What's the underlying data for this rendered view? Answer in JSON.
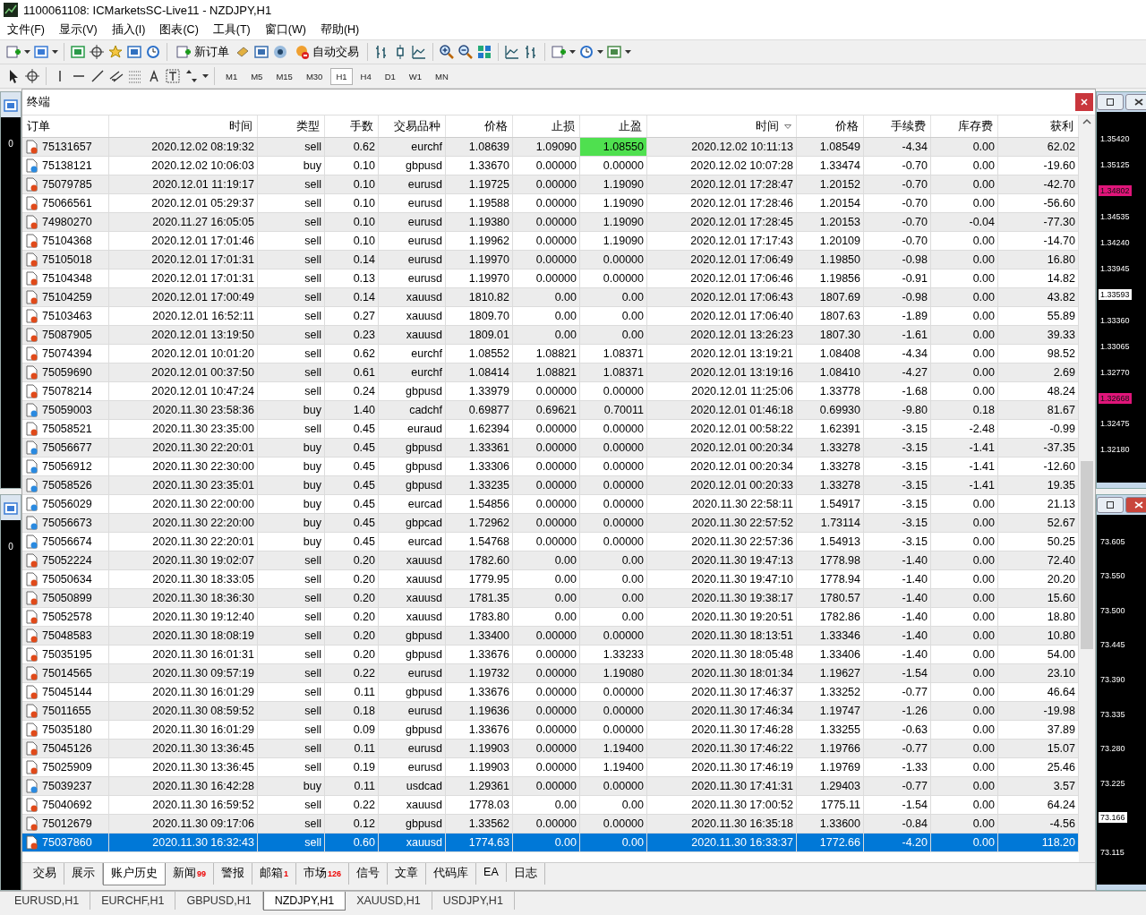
{
  "window": {
    "title": "1100061108: ICMarketsSC-Live11 - NZDJPY,H1"
  },
  "menu": [
    "文件(F)",
    "显示(V)",
    "插入(I)",
    "图表(C)",
    "工具(T)",
    "窗口(W)",
    "帮助(H)"
  ],
  "toolbar": {
    "new_order": "新订单",
    "auto_trading": "自动交易"
  },
  "timeframes": [
    {
      "label": "M1",
      "selected": false
    },
    {
      "label": "M5",
      "selected": false
    },
    {
      "label": "M15",
      "selected": false
    },
    {
      "label": "M30",
      "selected": false
    },
    {
      "label": "H1",
      "selected": true
    },
    {
      "label": "H4",
      "selected": false
    },
    {
      "label": "D1",
      "selected": false
    },
    {
      "label": "W1",
      "selected": false
    },
    {
      "label": "MN",
      "selected": false
    }
  ],
  "left_charts": [
    {
      "label": "0"
    },
    {
      "label": "0"
    }
  ],
  "terminal": {
    "title": "终端",
    "columns": [
      "订单",
      "时间",
      "类型",
      "手数",
      "交易品种",
      "价格",
      "止损",
      "止盈",
      "时间",
      "价格",
      "手续费",
      "库存费",
      "获利"
    ],
    "rows": [
      {
        "kind": "sell",
        "selected": false,
        "tp_hit": true,
        "cells": [
          "75131657",
          "2020.12.02 08:19:32",
          "sell",
          "0.62",
          "eurchf",
          "1.08639",
          "1.09090",
          "1.08550",
          "2020.12.02 10:11:13",
          "1.08549",
          "-4.34",
          "0.00",
          "62.02"
        ]
      },
      {
        "kind": "buy",
        "selected": false,
        "tp_hit": false,
        "cells": [
          "75138121",
          "2020.12.02 10:06:03",
          "buy",
          "0.10",
          "gbpusd",
          "1.33670",
          "0.00000",
          "0.00000",
          "2020.12.02 10:07:28",
          "1.33474",
          "-0.70",
          "0.00",
          "-19.60"
        ]
      },
      {
        "kind": "sell",
        "selected": false,
        "tp_hit": false,
        "cells": [
          "75079785",
          "2020.12.01 11:19:17",
          "sell",
          "0.10",
          "eurusd",
          "1.19725",
          "0.00000",
          "1.19090",
          "2020.12.01 17:28:47",
          "1.20152",
          "-0.70",
          "0.00",
          "-42.70"
        ]
      },
      {
        "kind": "sell",
        "selected": false,
        "tp_hit": false,
        "cells": [
          "75066561",
          "2020.12.01 05:29:37",
          "sell",
          "0.10",
          "eurusd",
          "1.19588",
          "0.00000",
          "1.19090",
          "2020.12.01 17:28:46",
          "1.20154",
          "-0.70",
          "0.00",
          "-56.60"
        ]
      },
      {
        "kind": "sell",
        "selected": false,
        "tp_hit": false,
        "cells": [
          "74980270",
          "2020.11.27 16:05:05",
          "sell",
          "0.10",
          "eurusd",
          "1.19380",
          "0.00000",
          "1.19090",
          "2020.12.01 17:28:45",
          "1.20153",
          "-0.70",
          "-0.04",
          "-77.30"
        ]
      },
      {
        "kind": "sell",
        "selected": false,
        "tp_hit": false,
        "cells": [
          "75104368",
          "2020.12.01 17:01:46",
          "sell",
          "0.10",
          "eurusd",
          "1.19962",
          "0.00000",
          "1.19090",
          "2020.12.01 17:17:43",
          "1.20109",
          "-0.70",
          "0.00",
          "-14.70"
        ]
      },
      {
        "kind": "sell",
        "selected": false,
        "tp_hit": false,
        "cells": [
          "75105018",
          "2020.12.01 17:01:31",
          "sell",
          "0.14",
          "eurusd",
          "1.19970",
          "0.00000",
          "0.00000",
          "2020.12.01 17:06:49",
          "1.19850",
          "-0.98",
          "0.00",
          "16.80"
        ]
      },
      {
        "kind": "sell",
        "selected": false,
        "tp_hit": false,
        "cells": [
          "75104348",
          "2020.12.01 17:01:31",
          "sell",
          "0.13",
          "eurusd",
          "1.19970",
          "0.00000",
          "0.00000",
          "2020.12.01 17:06:46",
          "1.19856",
          "-0.91",
          "0.00",
          "14.82"
        ]
      },
      {
        "kind": "sell",
        "selected": false,
        "tp_hit": false,
        "cells": [
          "75104259",
          "2020.12.01 17:00:49",
          "sell",
          "0.14",
          "xauusd",
          "1810.82",
          "0.00",
          "0.00",
          "2020.12.01 17:06:43",
          "1807.69",
          "-0.98",
          "0.00",
          "43.82"
        ]
      },
      {
        "kind": "sell",
        "selected": false,
        "tp_hit": false,
        "cells": [
          "75103463",
          "2020.12.01 16:52:11",
          "sell",
          "0.27",
          "xauusd",
          "1809.70",
          "0.00",
          "0.00",
          "2020.12.01 17:06:40",
          "1807.63",
          "-1.89",
          "0.00",
          "55.89"
        ]
      },
      {
        "kind": "sell",
        "selected": false,
        "tp_hit": false,
        "cells": [
          "75087905",
          "2020.12.01 13:19:50",
          "sell",
          "0.23",
          "xauusd",
          "1809.01",
          "0.00",
          "0.00",
          "2020.12.01 13:26:23",
          "1807.30",
          "-1.61",
          "0.00",
          "39.33"
        ]
      },
      {
        "kind": "sell",
        "selected": false,
        "tp_hit": false,
        "cells": [
          "75074394",
          "2020.12.01 10:01:20",
          "sell",
          "0.62",
          "eurchf",
          "1.08552",
          "1.08821",
          "1.08371",
          "2020.12.01 13:19:21",
          "1.08408",
          "-4.34",
          "0.00",
          "98.52"
        ]
      },
      {
        "kind": "sell",
        "selected": false,
        "tp_hit": false,
        "cells": [
          "75059690",
          "2020.12.01 00:37:50",
          "sell",
          "0.61",
          "eurchf",
          "1.08414",
          "1.08821",
          "1.08371",
          "2020.12.01 13:19:16",
          "1.08410",
          "-4.27",
          "0.00",
          "2.69"
        ]
      },
      {
        "kind": "sell",
        "selected": false,
        "tp_hit": false,
        "cells": [
          "75078214",
          "2020.12.01 10:47:24",
          "sell",
          "0.24",
          "gbpusd",
          "1.33979",
          "0.00000",
          "0.00000",
          "2020.12.01 11:25:06",
          "1.33778",
          "-1.68",
          "0.00",
          "48.24"
        ]
      },
      {
        "kind": "buy",
        "selected": false,
        "tp_hit": false,
        "cells": [
          "75059003",
          "2020.11.30 23:58:36",
          "buy",
          "1.40",
          "cadchf",
          "0.69877",
          "0.69621",
          "0.70011",
          "2020.12.01 01:46:18",
          "0.69930",
          "-9.80",
          "0.18",
          "81.67"
        ]
      },
      {
        "kind": "sell",
        "selected": false,
        "tp_hit": false,
        "cells": [
          "75058521",
          "2020.11.30 23:35:00",
          "sell",
          "0.45",
          "euraud",
          "1.62394",
          "0.00000",
          "0.00000",
          "2020.12.01 00:58:22",
          "1.62391",
          "-3.15",
          "-2.48",
          "-0.99"
        ]
      },
      {
        "kind": "buy",
        "selected": false,
        "tp_hit": false,
        "cells": [
          "75056677",
          "2020.11.30 22:20:01",
          "buy",
          "0.45",
          "gbpusd",
          "1.33361",
          "0.00000",
          "0.00000",
          "2020.12.01 00:20:34",
          "1.33278",
          "-3.15",
          "-1.41",
          "-37.35"
        ]
      },
      {
        "kind": "buy",
        "selected": false,
        "tp_hit": false,
        "cells": [
          "75056912",
          "2020.11.30 22:30:00",
          "buy",
          "0.45",
          "gbpusd",
          "1.33306",
          "0.00000",
          "0.00000",
          "2020.12.01 00:20:34",
          "1.33278",
          "-3.15",
          "-1.41",
          "-12.60"
        ]
      },
      {
        "kind": "buy",
        "selected": false,
        "tp_hit": false,
        "cells": [
          "75058526",
          "2020.11.30 23:35:01",
          "buy",
          "0.45",
          "gbpusd",
          "1.33235",
          "0.00000",
          "0.00000",
          "2020.12.01 00:20:33",
          "1.33278",
          "-3.15",
          "-1.41",
          "19.35"
        ]
      },
      {
        "kind": "buy",
        "selected": false,
        "tp_hit": false,
        "cells": [
          "75056029",
          "2020.11.30 22:00:00",
          "buy",
          "0.45",
          "eurcad",
          "1.54856",
          "0.00000",
          "0.00000",
          "2020.11.30 22:58:11",
          "1.54917",
          "-3.15",
          "0.00",
          "21.13"
        ]
      },
      {
        "kind": "buy",
        "selected": false,
        "tp_hit": false,
        "cells": [
          "75056673",
          "2020.11.30 22:20:00",
          "buy",
          "0.45",
          "gbpcad",
          "1.72962",
          "0.00000",
          "0.00000",
          "2020.11.30 22:57:52",
          "1.73114",
          "-3.15",
          "0.00",
          "52.67"
        ]
      },
      {
        "kind": "buy",
        "selected": false,
        "tp_hit": false,
        "cells": [
          "75056674",
          "2020.11.30 22:20:01",
          "buy",
          "0.45",
          "eurcad",
          "1.54768",
          "0.00000",
          "0.00000",
          "2020.11.30 22:57:36",
          "1.54913",
          "-3.15",
          "0.00",
          "50.25"
        ]
      },
      {
        "kind": "sell",
        "selected": false,
        "tp_hit": false,
        "cells": [
          "75052224",
          "2020.11.30 19:02:07",
          "sell",
          "0.20",
          "xauusd",
          "1782.60",
          "0.00",
          "0.00",
          "2020.11.30 19:47:13",
          "1778.98",
          "-1.40",
          "0.00",
          "72.40"
        ]
      },
      {
        "kind": "sell",
        "selected": false,
        "tp_hit": false,
        "cells": [
          "75050634",
          "2020.11.30 18:33:05",
          "sell",
          "0.20",
          "xauusd",
          "1779.95",
          "0.00",
          "0.00",
          "2020.11.30 19:47:10",
          "1778.94",
          "-1.40",
          "0.00",
          "20.20"
        ]
      },
      {
        "kind": "sell",
        "selected": false,
        "tp_hit": false,
        "cells": [
          "75050899",
          "2020.11.30 18:36:30",
          "sell",
          "0.20",
          "xauusd",
          "1781.35",
          "0.00",
          "0.00",
          "2020.11.30 19:38:17",
          "1780.57",
          "-1.40",
          "0.00",
          "15.60"
        ]
      },
      {
        "kind": "sell",
        "selected": false,
        "tp_hit": false,
        "cells": [
          "75052578",
          "2020.11.30 19:12:40",
          "sell",
          "0.20",
          "xauusd",
          "1783.80",
          "0.00",
          "0.00",
          "2020.11.30 19:20:51",
          "1782.86",
          "-1.40",
          "0.00",
          "18.80"
        ]
      },
      {
        "kind": "sell",
        "selected": false,
        "tp_hit": false,
        "cells": [
          "75048583",
          "2020.11.30 18:08:19",
          "sell",
          "0.20",
          "gbpusd",
          "1.33400",
          "0.00000",
          "0.00000",
          "2020.11.30 18:13:51",
          "1.33346",
          "-1.40",
          "0.00",
          "10.80"
        ]
      },
      {
        "kind": "sell",
        "selected": false,
        "tp_hit": false,
        "cells": [
          "75035195",
          "2020.11.30 16:01:31",
          "sell",
          "0.20",
          "gbpusd",
          "1.33676",
          "0.00000",
          "1.33233",
          "2020.11.30 18:05:48",
          "1.33406",
          "-1.40",
          "0.00",
          "54.00"
        ]
      },
      {
        "kind": "sell",
        "selected": false,
        "tp_hit": false,
        "cells": [
          "75014565",
          "2020.11.30 09:57:19",
          "sell",
          "0.22",
          "eurusd",
          "1.19732",
          "0.00000",
          "1.19080",
          "2020.11.30 18:01:34",
          "1.19627",
          "-1.54",
          "0.00",
          "23.10"
        ]
      },
      {
        "kind": "sell",
        "selected": false,
        "tp_hit": false,
        "cells": [
          "75045144",
          "2020.11.30 16:01:29",
          "sell",
          "0.11",
          "gbpusd",
          "1.33676",
          "0.00000",
          "0.00000",
          "2020.11.30 17:46:37",
          "1.33252",
          "-0.77",
          "0.00",
          "46.64"
        ]
      },
      {
        "kind": "sell",
        "selected": false,
        "tp_hit": false,
        "cells": [
          "75011655",
          "2020.11.30 08:59:52",
          "sell",
          "0.18",
          "eurusd",
          "1.19636",
          "0.00000",
          "0.00000",
          "2020.11.30 17:46:34",
          "1.19747",
          "-1.26",
          "0.00",
          "-19.98"
        ]
      },
      {
        "kind": "sell",
        "selected": false,
        "tp_hit": false,
        "cells": [
          "75035180",
          "2020.11.30 16:01:29",
          "sell",
          "0.09",
          "gbpusd",
          "1.33676",
          "0.00000",
          "0.00000",
          "2020.11.30 17:46:28",
          "1.33255",
          "-0.63",
          "0.00",
          "37.89"
        ]
      },
      {
        "kind": "sell",
        "selected": false,
        "tp_hit": false,
        "cells": [
          "75045126",
          "2020.11.30 13:36:45",
          "sell",
          "0.11",
          "eurusd",
          "1.19903",
          "0.00000",
          "1.19400",
          "2020.11.30 17:46:22",
          "1.19766",
          "-0.77",
          "0.00",
          "15.07"
        ]
      },
      {
        "kind": "sell",
        "selected": false,
        "tp_hit": false,
        "cells": [
          "75025909",
          "2020.11.30 13:36:45",
          "sell",
          "0.19",
          "eurusd",
          "1.19903",
          "0.00000",
          "1.19400",
          "2020.11.30 17:46:19",
          "1.19769",
          "-1.33",
          "0.00",
          "25.46"
        ]
      },
      {
        "kind": "buy",
        "selected": false,
        "tp_hit": false,
        "cells": [
          "75039237",
          "2020.11.30 16:42:28",
          "buy",
          "0.11",
          "usdcad",
          "1.29361",
          "0.00000",
          "0.00000",
          "2020.11.30 17:41:31",
          "1.29403",
          "-0.77",
          "0.00",
          "3.57"
        ]
      },
      {
        "kind": "sell",
        "selected": false,
        "tp_hit": false,
        "cells": [
          "75040692",
          "2020.11.30 16:59:52",
          "sell",
          "0.22",
          "xauusd",
          "1778.03",
          "0.00",
          "0.00",
          "2020.11.30 17:00:52",
          "1775.11",
          "-1.54",
          "0.00",
          "64.24"
        ]
      },
      {
        "kind": "sell",
        "selected": false,
        "tp_hit": false,
        "cells": [
          "75012679",
          "2020.11.30 09:17:06",
          "sell",
          "0.12",
          "gbpusd",
          "1.33562",
          "0.00000",
          "0.00000",
          "2020.11.30 16:35:18",
          "1.33600",
          "-0.84",
          "0.00",
          "-4.56"
        ]
      },
      {
        "kind": "sell",
        "selected": true,
        "tp_hit": false,
        "cells": [
          "75037860",
          "2020.11.30 16:32:43",
          "sell",
          "0.60",
          "xauusd",
          "1774.63",
          "0.00",
          "0.00",
          "2020.11.30 16:33:37",
          "1772.66",
          "-4.20",
          "0.00",
          "118.20"
        ]
      }
    ],
    "tabs": [
      {
        "label": "交易",
        "selected": false
      },
      {
        "label": "展示",
        "selected": false
      },
      {
        "label": "账户历史",
        "selected": true
      },
      {
        "label": "新闻",
        "badge": "99",
        "selected": false
      },
      {
        "label": "警报",
        "selected": false
      },
      {
        "label": "邮箱",
        "badge": "1",
        "selected": false
      },
      {
        "label": "市场",
        "badge": "126",
        "selected": false
      },
      {
        "label": "信号",
        "selected": false
      },
      {
        "label": "文章",
        "selected": false
      },
      {
        "label": "代码库",
        "selected": false
      },
      {
        "label": "EA",
        "selected": false
      },
      {
        "label": "日志",
        "selected": false
      }
    ]
  },
  "right_axes": [
    {
      "labels": [
        {
          "value": "1.35420",
          "kind": "tick"
        },
        {
          "value": "1.35125",
          "kind": "tick"
        },
        {
          "value": "1.34802",
          "kind": "alert"
        },
        {
          "value": "1.34535",
          "kind": "tick"
        },
        {
          "value": "1.34240",
          "kind": "tick"
        },
        {
          "value": "1.33945",
          "kind": "tick"
        },
        {
          "value": "1.33593",
          "kind": "price"
        },
        {
          "value": "1.33360",
          "kind": "tick"
        },
        {
          "value": "1.33065",
          "kind": "tick"
        },
        {
          "value": "1.32770",
          "kind": "tick"
        },
        {
          "value": "1.32668",
          "kind": "alert"
        },
        {
          "value": "1.32475",
          "kind": "tick"
        },
        {
          "value": "1.32180",
          "kind": "tick"
        }
      ]
    },
    {
      "labels": [
        {
          "value": "73.605",
          "kind": "tick"
        },
        {
          "value": "73.550",
          "kind": "tick"
        },
        {
          "value": "73.500",
          "kind": "tick"
        },
        {
          "value": "73.445",
          "kind": "tick"
        },
        {
          "value": "73.390",
          "kind": "tick"
        },
        {
          "value": "73.335",
          "kind": "tick"
        },
        {
          "value": "73.280",
          "kind": "tick"
        },
        {
          "value": "73.225",
          "kind": "tick"
        },
        {
          "value": "73.166",
          "kind": "price"
        },
        {
          "value": "73.115",
          "kind": "tick"
        }
      ]
    }
  ],
  "chart_tabs": [
    {
      "label": "EURUSD,H1",
      "selected": false
    },
    {
      "label": "EURCHF,H1",
      "selected": false
    },
    {
      "label": "GBPUSD,H1",
      "selected": false
    },
    {
      "label": "NZDJPY,H1",
      "selected": true
    },
    {
      "label": "XAUUSD,H1",
      "selected": false
    },
    {
      "label": "USDJPY,H1",
      "selected": false
    }
  ]
}
